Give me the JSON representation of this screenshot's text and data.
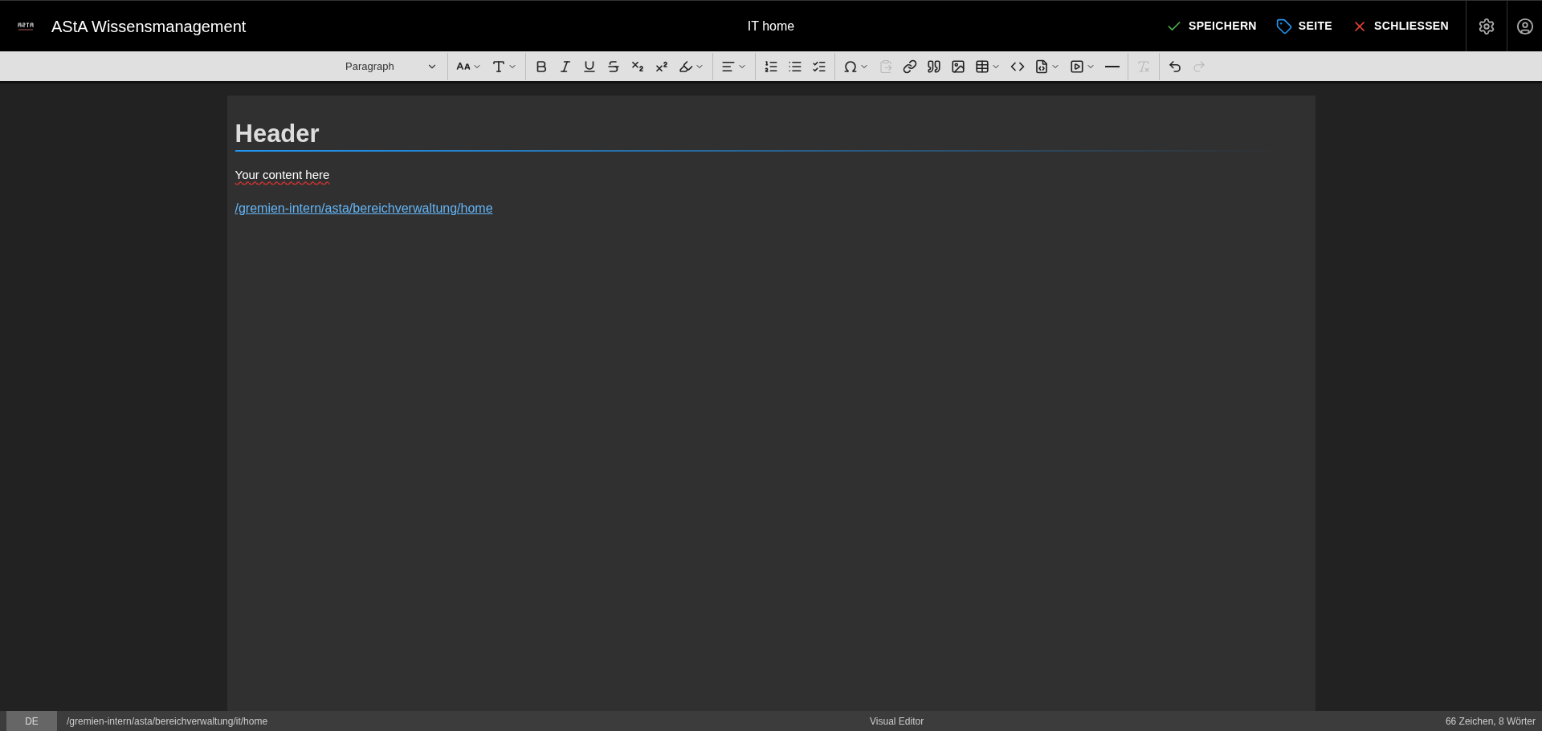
{
  "header": {
    "title": "AStA Wissensmanagement",
    "page_title": "IT home",
    "actions": [
      {
        "kind": "save",
        "label": "SPEICHERN"
      },
      {
        "kind": "page",
        "label": "SEITE"
      },
      {
        "kind": "close",
        "label": "SCHLIESSEN"
      }
    ]
  },
  "toolbar": {
    "format": {
      "value": "Paragraph"
    },
    "groups": [
      [
        {
          "menu": true,
          "disabled": false
        },
        {
          "menu": true,
          "disabled": false
        }
      ],
      [
        {
          "menu": false,
          "disabled": false
        },
        {
          "menu": false,
          "disabled": false
        },
        {
          "menu": false,
          "disabled": false
        },
        {
          "menu": false,
          "disabled": false
        },
        {
          "menu": false,
          "disabled": false
        },
        {
          "menu": false,
          "disabled": false
        },
        {
          "menu": true,
          "disabled": false
        }
      ],
      [
        {
          "menu": true,
          "disabled": false
        }
      ],
      [
        {
          "menu": false,
          "disabled": false
        },
        {
          "menu": false,
          "disabled": false
        },
        {
          "menu": false,
          "disabled": false
        }
      ],
      [
        {
          "menu": true,
          "disabled": false
        },
        {
          "menu": false,
          "disabled": true
        },
        {
          "menu": false,
          "disabled": false
        },
        {
          "menu": false,
          "disabled": false
        },
        {
          "menu": false,
          "disabled": false
        },
        {
          "menu": true,
          "disabled": false
        },
        {
          "menu": false,
          "disabled": false
        },
        {
          "menu": true,
          "disabled": false
        },
        {
          "menu": true,
          "disabled": false
        },
        {
          "menu": false,
          "disabled": false
        }
      ],
      [
        {
          "menu": false,
          "disabled": true
        }
      ],
      [
        {
          "menu": false,
          "disabled": false
        },
        {
          "menu": false,
          "disabled": true
        }
      ]
    ]
  },
  "document": {
    "heading": "Header",
    "paragraph": "Your content here",
    "link": "/gremien-intern/asta/bereichverwaltung/home"
  },
  "status_bar": {
    "locale": "DE",
    "path": "/gremien-intern/asta/bereichverwaltung/it/home",
    "mode": "Visual Editor",
    "count": "66 Zeichen, 8 Wörter"
  }
}
